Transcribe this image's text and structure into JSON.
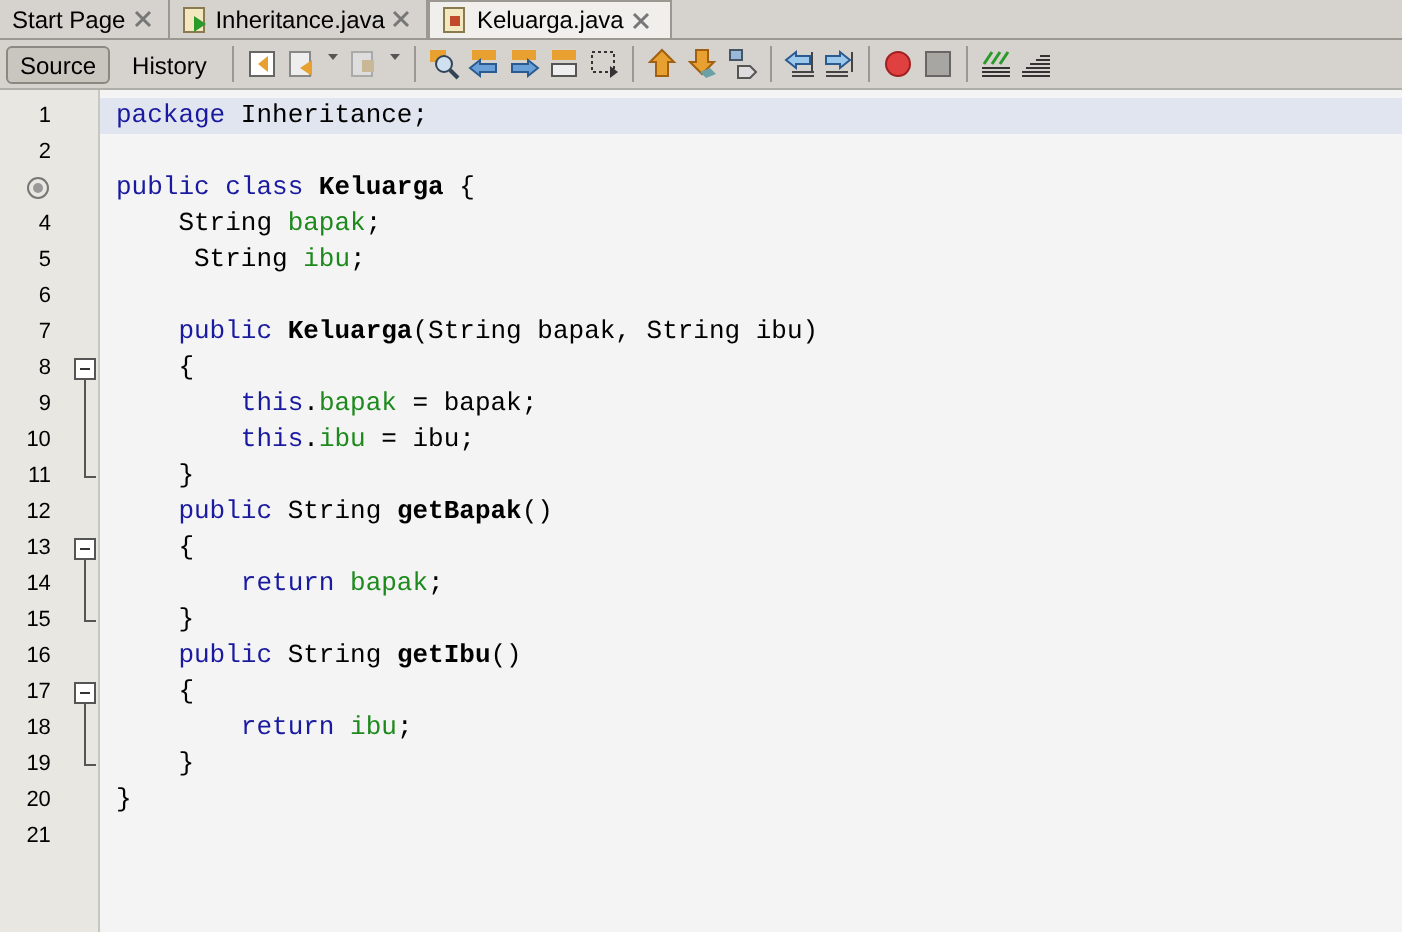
{
  "tabs": [
    {
      "label": "Start Page",
      "selected": false,
      "kind": "page"
    },
    {
      "label": "Inheritance.java",
      "selected": false,
      "kind": "java-run"
    },
    {
      "label": "Keluarga.java",
      "selected": true,
      "kind": "java"
    }
  ],
  "view_buttons": [
    {
      "label": "Source",
      "selected": true
    },
    {
      "label": "History",
      "selected": false
    }
  ],
  "lines": [
    {
      "number": "1",
      "kind": "plain",
      "highlighted": true,
      "tokens": [
        {
          "text": "package",
          "kind": "keyword"
        },
        {
          "text": " Inheritance;",
          "kind": "plain"
        }
      ]
    },
    {
      "number": "2",
      "kind": "plain",
      "highlighted": false
    },
    {
      "kind": "marker",
      "highlighted": false,
      "tokens": [
        {
          "text": "public class ",
          "kind": "keyword"
        },
        {
          "text": "Keluarga",
          "kind": "bold"
        },
        {
          "text": " {",
          "kind": "plain"
        }
      ]
    },
    {
      "number": "4",
      "kind": "plain",
      "highlighted": false,
      "tokens": [
        {
          "text": "    String ",
          "kind": "plain"
        },
        {
          "text": "bapak",
          "kind": "field"
        },
        {
          "text": ";",
          "kind": "plain"
        }
      ]
    },
    {
      "number": "5",
      "kind": "plain",
      "highlighted": false,
      "tokens": [
        {
          "text": "     String ",
          "kind": "plain"
        },
        {
          "text": "ibu",
          "kind": "field"
        },
        {
          "text": ";",
          "kind": "plain"
        }
      ]
    },
    {
      "number": "6",
      "kind": "plain",
      "highlighted": false
    },
    {
      "number": "7",
      "kind": "plain",
      "highlighted": false,
      "tokens": [
        {
          "text": "    public ",
          "kind": "keyword"
        },
        {
          "text": "Keluarga",
          "kind": "bold"
        },
        {
          "text": "(String bapak, String ibu)",
          "kind": "plain"
        }
      ]
    },
    {
      "number": "8",
      "kind": "fold-start",
      "highlighted": false,
      "tokens": [
        {
          "text": "    {",
          "kind": "plain"
        }
      ]
    },
    {
      "number": "9",
      "kind": "fold-body",
      "highlighted": false,
      "tokens": [
        {
          "text": "        this",
          "kind": "keyword"
        },
        {
          "text": ".",
          "kind": "plain"
        },
        {
          "text": "bapak",
          "kind": "field"
        },
        {
          "text": " = bapak;",
          "kind": "plain"
        }
      ]
    },
    {
      "number": "10",
      "kind": "fold-body",
      "highlighted": false,
      "tokens": [
        {
          "text": "        this",
          "kind": "keyword"
        },
        {
          "text": ".",
          "kind": "plain"
        },
        {
          "text": "ibu",
          "kind": "field"
        },
        {
          "text": " = ibu;",
          "kind": "plain"
        }
      ]
    },
    {
      "number": "11",
      "kind": "fold-end",
      "highlighted": false,
      "tokens": [
        {
          "text": "    }",
          "kind": "plain"
        }
      ]
    },
    {
      "number": "12",
      "kind": "plain",
      "highlighted": false,
      "tokens": [
        {
          "text": "    public",
          "kind": "keyword"
        },
        {
          "text": " String ",
          "kind": "plain"
        },
        {
          "text": "getBapak",
          "kind": "bold"
        },
        {
          "text": "()",
          "kind": "plain"
        }
      ]
    },
    {
      "number": "13",
      "kind": "fold-start",
      "highlighted": false,
      "tokens": [
        {
          "text": "    {",
          "kind": "plain"
        }
      ]
    },
    {
      "number": "14",
      "kind": "fold-body",
      "highlighted": false,
      "tokens": [
        {
          "text": "        return ",
          "kind": "keyword"
        },
        {
          "text": "bapak",
          "kind": "field"
        },
        {
          "text": ";",
          "kind": "plain"
        }
      ]
    },
    {
      "number": "15",
      "kind": "fold-end",
      "highlighted": false,
      "tokens": [
        {
          "text": "    }",
          "kind": "plain"
        }
      ]
    },
    {
      "number": "16",
      "kind": "plain",
      "highlighted": false,
      "tokens": [
        {
          "text": "    public",
          "kind": "keyword"
        },
        {
          "text": " String ",
          "kind": "plain"
        },
        {
          "text": "getIbu",
          "kind": "bold"
        },
        {
          "text": "()",
          "kind": "plain"
        }
      ]
    },
    {
      "number": "17",
      "kind": "fold-start",
      "highlighted": false,
      "tokens": [
        {
          "text": "    {",
          "kind": "plain"
        }
      ]
    },
    {
      "number": "18",
      "kind": "fold-body",
      "highlighted": false,
      "tokens": [
        {
          "text": "        return ",
          "kind": "keyword"
        },
        {
          "text": "ibu",
          "kind": "field"
        },
        {
          "text": ";",
          "kind": "plain"
        }
      ]
    },
    {
      "number": "19",
      "kind": "fold-end",
      "highlighted": false,
      "tokens": [
        {
          "text": "    }",
          "kind": "plain"
        }
      ]
    },
    {
      "number": "20",
      "kind": "plain",
      "highlighted": false,
      "tokens": [
        {
          "text": "}",
          "kind": "plain"
        }
      ]
    },
    {
      "number": "21",
      "kind": "plain",
      "highlighted": false
    }
  ]
}
